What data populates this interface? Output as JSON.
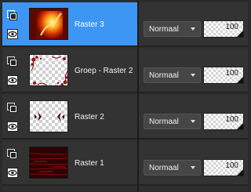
{
  "layers": [
    {
      "name": "Raster 3",
      "blend_mode": "Normaal",
      "opacity": "100",
      "selected": true,
      "thumb": "flame-image"
    },
    {
      "name": "Groep - Raster 2",
      "blend_mode": "Normaal",
      "opacity": "100",
      "selected": false,
      "thumb": "floral-frame"
    },
    {
      "name": "Raster 2",
      "blend_mode": "Normaal",
      "opacity": "100",
      "selected": false,
      "thumb": "dark-ornaments"
    },
    {
      "name": "Raster 1",
      "blend_mode": "Normaal",
      "opacity": "100",
      "selected": false,
      "thumb": "dark-red-texture"
    }
  ],
  "colors": {
    "panel_bg": "#2b2b2b",
    "row_bg": "#333333",
    "selected_bg": "#3d96f4",
    "dropdown_bg": "#464646"
  },
  "icons": {
    "group": "layer-group-icon",
    "visibility": "eye-icon",
    "dropdown": "chevron-down-icon"
  }
}
